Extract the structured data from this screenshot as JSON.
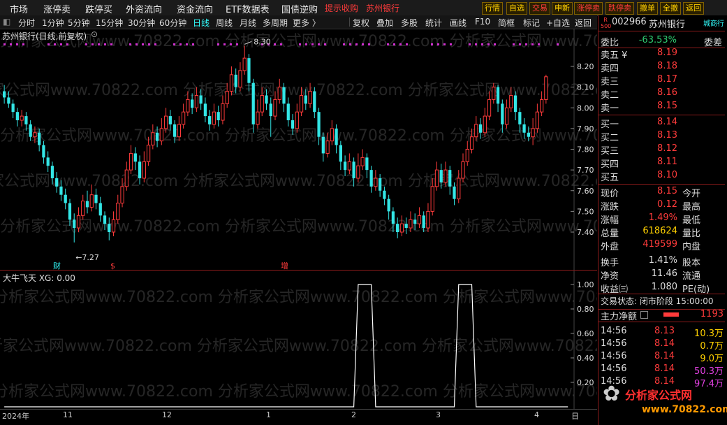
{
  "menu": [
    "市场",
    "涨停卖",
    "跌停买",
    "外资流向",
    "资金流向",
    "ETF数据表",
    "国债逆购",
    "提示收购",
    "苏州银行"
  ],
  "toolbar": [
    "行情",
    "自选",
    "交易",
    "申新",
    "涨停卖",
    "跌停卖",
    "撤单",
    "全撤",
    "返回"
  ],
  "periods": [
    "分时",
    "1分钟",
    "5分钟",
    "15分钟",
    "30分钟",
    "60分钟",
    "日线",
    "周线",
    "月线",
    "多周期",
    "更多 〉"
  ],
  "tools": [
    "复权",
    "叠加",
    "多股",
    "统计",
    "画线",
    "F10",
    "简框",
    "标记",
    "+自选",
    "返回"
  ],
  "chart_title": "苏州银行(日线,前复权)",
  "indicator_title": "大牛飞天  XG: 0.00",
  "watermark": "分析家公式网www.70822.com",
  "logo_text": "分析家公式网",
  "logo_url": "www.70822.com",
  "price_axis": [
    "8.20",
    "8.10",
    "8.00",
    "7.90",
    "7.80",
    "7.70",
    "7.60",
    "7.50",
    "7.40"
  ],
  "ind_axis": [
    "1.00",
    "0.80",
    "0.60",
    "0.40",
    "0.20"
  ],
  "time_axis": [
    "2024年",
    "11",
    "12",
    "1",
    "2",
    "3",
    "4",
    "日"
  ],
  "annot": {
    "high": "8.30",
    "low": "7.27",
    "cai": "财",
    "s": "$",
    "zeng": "增"
  },
  "quote": {
    "badge": "R 500",
    "code": "002966",
    "name": "苏州银行",
    "tag": "城商行",
    "weibi_label": "委比",
    "weibi": "-63.53%",
    "weicha_label": "委差",
    "asks": [
      {
        "l": "卖五 ¥",
        "p": "8.19"
      },
      {
        "l": "卖四",
        "p": "8.18"
      },
      {
        "l": "卖三",
        "p": "8.17"
      },
      {
        "l": "卖二",
        "p": "8.16"
      },
      {
        "l": "卖一",
        "p": "8.15"
      }
    ],
    "bids": [
      {
        "l": "买一",
        "p": "8.14"
      },
      {
        "l": "买二",
        "p": "8.13"
      },
      {
        "l": "买三",
        "p": "8.12"
      },
      {
        "l": "买四",
        "p": "8.11"
      },
      {
        "l": "买五",
        "p": "8.10"
      }
    ],
    "stats": [
      {
        "l": "现价",
        "v": "8.15",
        "c": "red",
        "r": "今开"
      },
      {
        "l": "涨跌",
        "v": "0.12",
        "c": "red",
        "r": "最高"
      },
      {
        "l": "涨幅",
        "v": "1.49%",
        "c": "red",
        "r": "最低"
      },
      {
        "l": "总量",
        "v": "618624",
        "c": "yellow",
        "r": "量比"
      },
      {
        "l": "外盘",
        "v": "419599",
        "c": "red",
        "r": "内盘"
      },
      {
        "l": "换手",
        "v": "1.41%",
        "c": "white",
        "r": "股本"
      },
      {
        "l": "净资",
        "v": "11.46",
        "c": "white",
        "r": "流通"
      },
      {
        "l": "收益㈢",
        "v": "1.080",
        "c": "white",
        "r": "PE(动)"
      }
    ],
    "trade_status": "交易状态: 闭市阶段 15:00:00",
    "main_flow_label": "主力净额",
    "main_flow_val": "1193",
    "ticks": [
      {
        "t": "14:56",
        "p": "8.13",
        "v": "10.3万",
        "vc": "yellow"
      },
      {
        "t": "14:56",
        "p": "8.14",
        "v": "0.7万",
        "vc": "yellow"
      },
      {
        "t": "14:56",
        "p": "8.14",
        "v": "9.0万",
        "vc": "yellow"
      },
      {
        "t": "14:56",
        "p": "8.14",
        "v": "50.3万",
        "vc": "mag"
      },
      {
        "t": "14:56",
        "p": "8.14",
        "v": "97.4万",
        "vc": "mag"
      }
    ]
  },
  "chart_data": {
    "type": "candlestick",
    "ylim": [
      7.27,
      8.3
    ],
    "candles": [
      [
        8.08,
        8.05,
        8.11,
        8.02
      ],
      [
        8.05,
        8.02,
        8.08,
        8.0
      ],
      [
        8.02,
        7.98,
        8.04,
        7.95
      ],
      [
        7.98,
        7.94,
        8.0,
        7.91
      ],
      [
        7.94,
        7.96,
        7.99,
        7.91
      ],
      [
        7.96,
        7.92,
        7.98,
        7.89
      ],
      [
        7.92,
        7.86,
        7.94,
        7.84
      ],
      [
        7.86,
        7.88,
        7.91,
        7.83
      ],
      [
        7.88,
        7.82,
        7.9,
        7.79
      ],
      [
        7.82,
        7.76,
        7.84,
        7.73
      ],
      [
        7.76,
        7.72,
        7.79,
        7.69
      ],
      [
        7.72,
        7.66,
        7.74,
        7.63
      ],
      [
        7.66,
        7.62,
        7.69,
        7.59
      ],
      [
        7.62,
        7.58,
        7.65,
        7.55
      ],
      [
        7.58,
        7.54,
        7.61,
        7.51
      ],
      [
        7.54,
        7.46,
        7.56,
        7.43
      ],
      [
        7.46,
        7.42,
        7.49,
        7.35
      ],
      [
        7.42,
        7.48,
        7.52,
        7.4
      ],
      [
        7.48,
        7.55,
        7.58,
        7.46
      ],
      [
        7.55,
        7.52,
        7.6,
        7.49
      ],
      [
        7.52,
        7.58,
        7.63,
        7.5
      ],
      [
        7.58,
        7.54,
        7.61,
        7.51
      ],
      [
        7.54,
        7.48,
        7.57,
        7.45
      ],
      [
        7.48,
        7.44,
        7.5,
        7.41
      ],
      [
        7.44,
        7.4,
        7.47,
        7.36
      ],
      [
        7.4,
        7.46,
        7.5,
        7.38
      ],
      [
        7.46,
        7.54,
        7.58,
        7.44
      ],
      [
        7.54,
        7.62,
        7.66,
        7.52
      ],
      [
        7.62,
        7.7,
        7.74,
        7.6
      ],
      [
        7.7,
        7.78,
        7.82,
        7.68
      ],
      [
        7.78,
        7.74,
        7.81,
        7.7
      ],
      [
        7.74,
        7.66,
        7.77,
        7.63
      ],
      [
        7.66,
        7.74,
        7.79,
        7.64
      ],
      [
        7.74,
        7.82,
        7.86,
        7.72
      ],
      [
        7.82,
        7.88,
        7.92,
        7.8
      ],
      [
        7.88,
        7.84,
        7.91,
        7.81
      ],
      [
        7.84,
        7.9,
        7.95,
        7.82
      ],
      [
        7.9,
        7.96,
        8.0,
        7.88
      ],
      [
        7.96,
        7.92,
        7.99,
        7.89
      ],
      [
        7.92,
        7.86,
        7.94,
        7.83
      ],
      [
        7.86,
        7.92,
        7.96,
        7.84
      ],
      [
        7.92,
        7.98,
        8.02,
        7.9
      ],
      [
        7.98,
        8.04,
        8.08,
        7.96
      ],
      [
        8.04,
        8.0,
        8.07,
        7.97
      ],
      [
        8.0,
        8.06,
        8.1,
        7.98
      ],
      [
        8.06,
        8.02,
        8.09,
        7.99
      ],
      [
        8.02,
        7.96,
        8.05,
        7.93
      ],
      [
        7.96,
        7.92,
        7.99,
        7.89
      ],
      [
        7.92,
        7.98,
        8.02,
        7.9
      ],
      [
        7.98,
        7.94,
        8.01,
        7.91
      ],
      [
        7.94,
        8.02,
        8.06,
        7.92
      ],
      [
        8.02,
        8.08,
        8.12,
        8.0
      ],
      [
        8.08,
        8.16,
        8.2,
        8.06
      ],
      [
        8.16,
        8.1,
        8.19,
        8.07
      ],
      [
        8.1,
        8.18,
        8.22,
        8.08
      ],
      [
        8.18,
        8.24,
        8.3,
        8.16
      ],
      [
        8.24,
        8.12,
        8.26,
        8.08
      ],
      [
        8.12,
        7.92,
        8.14,
        7.88
      ],
      [
        7.92,
        7.98,
        8.04,
        7.9
      ],
      [
        7.98,
        8.06,
        8.1,
        7.96
      ],
      [
        8.06,
        8.02,
        8.09,
        7.99
      ],
      [
        8.02,
        7.96,
        8.05,
        7.86
      ],
      [
        7.96,
        8.04,
        8.08,
        7.94
      ],
      [
        8.04,
        8.1,
        8.14,
        8.02
      ],
      [
        8.1,
        8.02,
        8.12,
        7.98
      ],
      [
        8.02,
        7.94,
        8.05,
        7.91
      ],
      [
        7.94,
        7.9,
        7.97,
        7.87
      ],
      [
        7.9,
        7.98,
        8.02,
        7.88
      ],
      [
        7.98,
        8.06,
        8.1,
        7.96
      ],
      [
        8.06,
        8.02,
        8.09,
        7.99
      ],
      [
        8.02,
        8.08,
        8.12,
        8.0
      ],
      [
        8.08,
        7.98,
        8.1,
        7.95
      ],
      [
        7.98,
        7.86,
        8.0,
        7.82
      ],
      [
        7.86,
        7.78,
        7.88,
        7.74
      ],
      [
        7.78,
        7.84,
        7.88,
        7.76
      ],
      [
        7.84,
        7.9,
        7.94,
        7.82
      ],
      [
        7.9,
        7.82,
        7.92,
        7.78
      ],
      [
        7.82,
        7.74,
        7.84,
        7.7
      ],
      [
        7.74,
        7.7,
        7.77,
        7.67
      ],
      [
        7.7,
        7.74,
        7.78,
        7.68
      ],
      [
        7.74,
        7.66,
        7.76,
        7.62
      ],
      [
        7.66,
        7.72,
        7.78,
        7.64
      ],
      [
        7.72,
        7.76,
        7.8,
        7.7
      ],
      [
        7.76,
        7.7,
        7.78,
        7.66
      ],
      [
        7.7,
        7.62,
        7.72,
        7.59
      ],
      [
        7.62,
        7.66,
        7.7,
        7.6
      ],
      [
        7.66,
        7.6,
        7.68,
        7.57
      ],
      [
        7.6,
        7.56,
        7.62,
        7.53
      ],
      [
        7.56,
        7.5,
        7.58,
        7.46
      ],
      [
        7.5,
        7.44,
        7.52,
        7.4
      ],
      [
        7.44,
        7.4,
        7.47,
        7.37
      ],
      [
        7.4,
        7.44,
        7.48,
        7.38
      ],
      [
        7.44,
        7.42,
        7.47,
        7.39
      ],
      [
        7.42,
        7.46,
        7.5,
        7.4
      ],
      [
        7.46,
        7.44,
        7.49,
        7.41
      ],
      [
        7.44,
        7.48,
        7.52,
        7.42
      ],
      [
        7.48,
        7.42,
        7.5,
        7.4
      ],
      [
        7.42,
        7.5,
        7.54,
        7.4
      ],
      [
        7.5,
        7.62,
        7.66,
        7.48
      ],
      [
        7.62,
        7.7,
        7.74,
        7.6
      ],
      [
        7.7,
        7.64,
        7.73,
        7.61
      ],
      [
        7.64,
        7.7,
        7.74,
        7.62
      ],
      [
        7.7,
        7.62,
        7.72,
        7.58
      ],
      [
        7.62,
        7.56,
        7.64,
        7.53
      ],
      [
        7.56,
        7.66,
        7.7,
        7.54
      ],
      [
        7.66,
        7.74,
        7.78,
        7.64
      ],
      [
        7.74,
        7.8,
        7.84,
        7.72
      ],
      [
        7.8,
        7.86,
        7.9,
        7.78
      ],
      [
        7.86,
        7.92,
        7.96,
        7.84
      ],
      [
        7.92,
        7.88,
        7.95,
        7.85
      ],
      [
        7.88,
        7.96,
        8.0,
        7.86
      ],
      [
        7.96,
        8.04,
        8.08,
        7.94
      ],
      [
        8.04,
        8.1,
        8.12,
        8.02
      ],
      [
        8.1,
        8.02,
        8.11,
        7.98
      ],
      [
        8.02,
        7.92,
        8.04,
        7.88
      ],
      [
        7.92,
        8.0,
        8.04,
        7.9
      ],
      [
        8.0,
        8.06,
        8.1,
        7.98
      ],
      [
        8.06,
        7.98,
        8.08,
        7.94
      ],
      [
        7.98,
        7.92,
        8.0,
        7.88
      ],
      [
        7.92,
        7.88,
        7.95,
        7.85
      ],
      [
        7.88,
        7.86,
        7.91,
        7.84
      ],
      [
        7.86,
        7.9,
        7.95,
        7.82
      ],
      [
        7.9,
        7.98,
        8.02,
        7.88
      ],
      [
        7.98,
        8.04,
        8.08,
        7.96
      ],
      [
        8.04,
        8.15,
        8.16,
        8.02
      ]
    ],
    "indicator": [
      0,
      0,
      0,
      0,
      0,
      0,
      0,
      0,
      0,
      0,
      0,
      0,
      0,
      0,
      0,
      0,
      0,
      0,
      0,
      0,
      0,
      0,
      0,
      0,
      0,
      0,
      0,
      0,
      0,
      0,
      0,
      0,
      0,
      0,
      0,
      0,
      0,
      0,
      0,
      0,
      0,
      0,
      0,
      0,
      0,
      0,
      0,
      0,
      0,
      0,
      0,
      0,
      0,
      0,
      0,
      0,
      0,
      0,
      0,
      0,
      0,
      0,
      0,
      0,
      0,
      0,
      0,
      0,
      0,
      0,
      0,
      0,
      0,
      0,
      0,
      0,
      0,
      0,
      0,
      0,
      0,
      1,
      1,
      1,
      1,
      0,
      0,
      0,
      0,
      0,
      0,
      0,
      0,
      0,
      0,
      0,
      0,
      0,
      0,
      0,
      0,
      0,
      0,
      0,
      1,
      1,
      1,
      1,
      0,
      0,
      0,
      0,
      0,
      0,
      0,
      0,
      0,
      0,
      0,
      0,
      0,
      0,
      0,
      0,
      0,
      0,
      0,
      0,
      0,
      0
    ]
  }
}
